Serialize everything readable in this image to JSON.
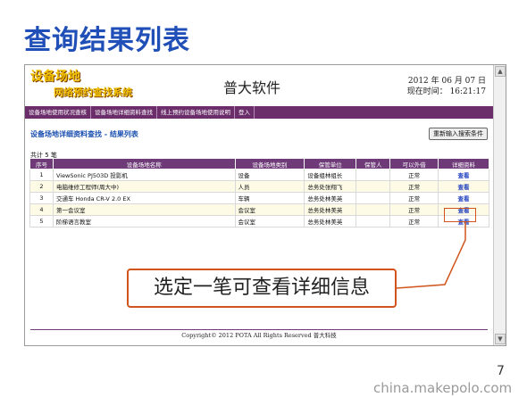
{
  "slide": {
    "title": "查询结果列表",
    "page_number": "7",
    "watermark": "china.makepolo.com"
  },
  "header": {
    "logo_line1": "设备场地",
    "logo_line2": "网络预约查找系统",
    "app_name": "普大软件",
    "date": "2012 年 06 月 07 日",
    "time": "现在时间： 16:21:17"
  },
  "nav": {
    "items": [
      "设备场地使用状况查核",
      "设备场地详细资料查找",
      "线上预约设备场地使用说明",
      "登入"
    ]
  },
  "page": {
    "heading": "设备场地详细资料查找 - 结果列表",
    "reenter_button": "重新输入搜索条件",
    "total": "共计 5 笔"
  },
  "table": {
    "headers": [
      "序号",
      "设备场地名称",
      "设备场地类别",
      "保管单位",
      "保管人",
      "可以外借",
      "详细资料"
    ],
    "rows": [
      {
        "no": "1",
        "name": "ViewSonic PJ503D 投影机",
        "category": "设备",
        "unit": "设备组林组长",
        "keeper": "",
        "status": "正常",
        "detail": "查看"
      },
      {
        "no": "2",
        "name": "电脑维修工程师(周大中)",
        "category": "人员",
        "unit": "总务处张翔飞",
        "keeper": "",
        "status": "正常",
        "detail": "查看"
      },
      {
        "no": "3",
        "name": "交通车 Honda CR-V 2.0 EX",
        "category": "车辆",
        "unit": "总务处林美英",
        "keeper": "",
        "status": "正常",
        "detail": "查看"
      },
      {
        "no": "4",
        "name": "第一会议室",
        "category": "会议室",
        "unit": "总务处林美英",
        "keeper": "",
        "status": "正常",
        "detail": "查看"
      },
      {
        "no": "5",
        "name": "阶梯语言教室",
        "category": "会议室",
        "unit": "总务处林美英",
        "keeper": "",
        "status": "正常",
        "detail": "查看"
      }
    ]
  },
  "annotation": {
    "callout_text": "选定一笔可查看详细信息",
    "color": "#d0541c"
  },
  "footer": {
    "copyright": "Copyright© 2012 POTA All Rights Reserved 普大科技"
  },
  "colors": {
    "title": "#1f4fb7",
    "nav_bg": "#6b2e6b",
    "table_header_bg": "#6e3a78",
    "logo": "#f2c200",
    "link": "#1f3fbf"
  }
}
